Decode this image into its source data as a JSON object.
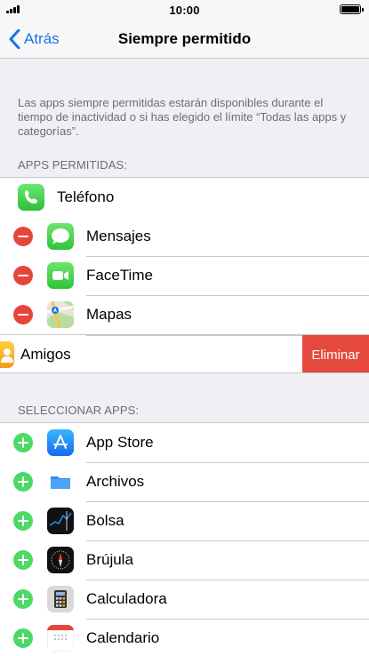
{
  "status_bar": {
    "time": "10:00",
    "signal_icon": "signal-bars-icon",
    "battery_icon": "battery-icon"
  },
  "nav": {
    "back_label": "Atrás",
    "title": "Siempre permitido"
  },
  "description": "Las apps siempre permitidas estarán disponibles durante el tiempo de inactividad o si has elegido el límite “Todas las apps y categorías”.",
  "allowed": {
    "header": "APPS PERMITIDAS:",
    "phone": {
      "label": "Teléfono",
      "icon": "phone-icon"
    },
    "items": [
      {
        "label": "Mensajes",
        "icon": "messages-icon"
      },
      {
        "label": "FaceTime",
        "icon": "facetime-icon"
      },
      {
        "label": "Mapas",
        "icon": "maps-icon"
      }
    ],
    "swiped": {
      "label": "Amigos",
      "icon": "friends-icon",
      "delete_label": "Eliminar"
    }
  },
  "select": {
    "header": "SELECCIONAR APPS:",
    "items": [
      {
        "label": "App Store",
        "icon": "app-store-icon"
      },
      {
        "label": "Archivos",
        "icon": "files-icon"
      },
      {
        "label": "Bolsa",
        "icon": "stocks-icon"
      },
      {
        "label": "Brújula",
        "icon": "compass-icon"
      },
      {
        "label": "Calculadora",
        "icon": "calculator-icon"
      },
      {
        "label": "Calendario",
        "icon": "calendar-icon"
      }
    ]
  },
  "colors": {
    "accent": "#1a73e8",
    "delete": "#e5483d",
    "add": "#4cd964",
    "remove": "#e6463a"
  }
}
